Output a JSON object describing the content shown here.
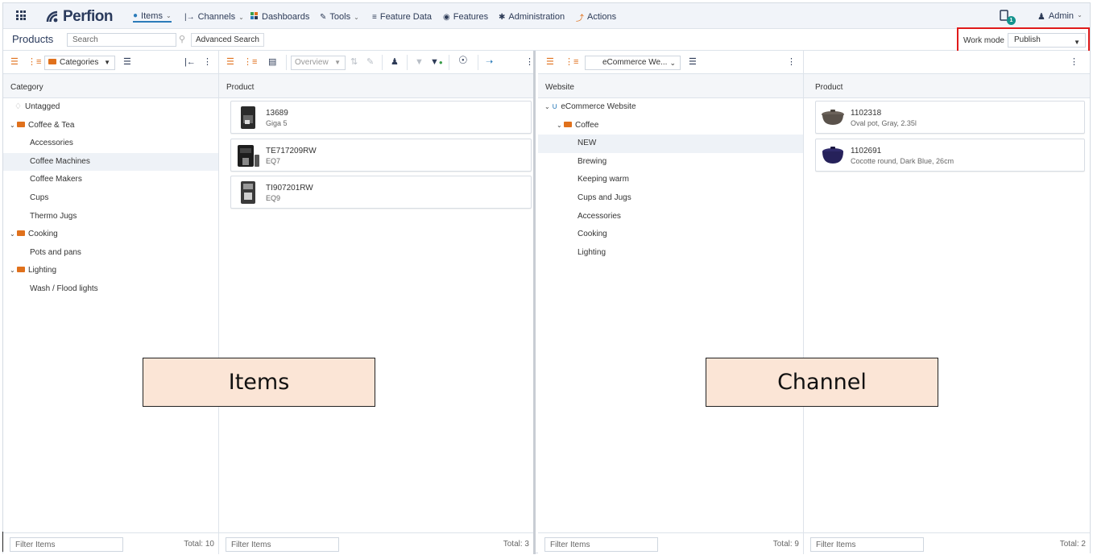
{
  "topnav": {
    "logo": "Perfion",
    "items": [
      {
        "label": "Items",
        "icon": "cube-icon"
      },
      {
        "label": "Channels",
        "icon": "channel-icon"
      },
      {
        "label": "Dashboards",
        "icon": "dashboard-icon"
      },
      {
        "label": "Tools",
        "icon": "wrench-icon"
      },
      {
        "label": "Feature Data",
        "icon": "list-icon"
      },
      {
        "label": "Features",
        "icon": "database-icon"
      },
      {
        "label": "Administration",
        "icon": "cog-icon"
      },
      {
        "label": "Actions",
        "icon": "lightning-icon"
      }
    ],
    "notification_count": "1",
    "user": "Admin"
  },
  "bar2": {
    "title": "Products",
    "search_placeholder": "Search",
    "advanced_search": "Advanced Search",
    "workmode_label": "Work mode",
    "workmode_value": "Publish"
  },
  "panel1": {
    "dropdown": "Categories",
    "column": "Category",
    "tree": [
      {
        "label": "Untagged",
        "type": "tag"
      },
      {
        "label": "Coffee & Tea",
        "type": "folder"
      },
      {
        "label": "Accessories",
        "type": "leaf"
      },
      {
        "label": "Coffee Machines",
        "type": "leaf",
        "selected": true
      },
      {
        "label": "Coffee Makers",
        "type": "leaf"
      },
      {
        "label": "Cups",
        "type": "leaf"
      },
      {
        "label": "Thermo Jugs",
        "type": "leaf"
      },
      {
        "label": "Cooking",
        "type": "folder"
      },
      {
        "label": "Pots and pans",
        "type": "leaf"
      },
      {
        "label": "Lighting",
        "type": "folder"
      },
      {
        "label": "Wash / Flood lights",
        "type": "leaf"
      }
    ],
    "filter_placeholder": "Filter Items",
    "total": "Total: 10"
  },
  "panel2": {
    "view": "Overview",
    "column": "Product",
    "cards": [
      {
        "id": "13689",
        "name": "Giga 5"
      },
      {
        "id": "TE717209RW",
        "name": "EQ7"
      },
      {
        "id": "TI907201RW",
        "name": "EQ9"
      }
    ],
    "filter_placeholder": "Filter Items",
    "total": "Total: 3"
  },
  "panel3": {
    "dropdown": "eCommerce We...",
    "column": "Website",
    "tree": [
      {
        "label": "eCommerce Website",
        "type": "root"
      },
      {
        "label": "Coffee",
        "type": "folder"
      },
      {
        "label": "NEW",
        "type": "leaf",
        "selected": true
      },
      {
        "label": "Brewing",
        "type": "leaf"
      },
      {
        "label": "Keeping warm",
        "type": "leaf"
      },
      {
        "label": "Cups and Jugs",
        "type": "leaf"
      },
      {
        "label": "Accessories",
        "type": "leaf"
      },
      {
        "label": "Cooking",
        "type": "leaf"
      },
      {
        "label": "Lighting",
        "type": "leaf"
      }
    ],
    "filter_placeholder": "Filter Items",
    "total": "Total: 9"
  },
  "panel4": {
    "column": "Product",
    "cards": [
      {
        "id": "1102318",
        "name": "Oval pot, Gray, 2.35l"
      },
      {
        "id": "1102691",
        "name": "Cocotte round, Dark Blue, 26cm"
      }
    ],
    "filter_placeholder": "Filter Items",
    "total": "Total: 2"
  },
  "callouts": {
    "items": "Items",
    "channel": "Channel"
  },
  "colors": {
    "accent": "#e0711c",
    "nav_text": "#2d3b57",
    "highlight_border": "#e01b1b",
    "callout_bg": "#fbe5d6"
  }
}
